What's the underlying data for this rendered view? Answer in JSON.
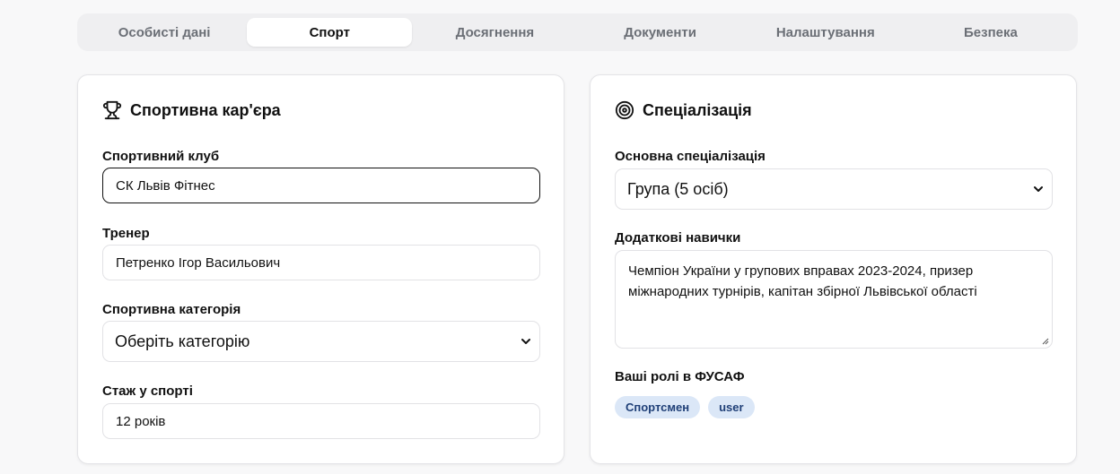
{
  "tabs": [
    {
      "label": "Особисті дані",
      "active": false
    },
    {
      "label": "Спорт",
      "active": true
    },
    {
      "label": "Досягнення",
      "active": false
    },
    {
      "label": "Документи",
      "active": false
    },
    {
      "label": "Налаштування",
      "active": false
    },
    {
      "label": "Безпека",
      "active": false
    }
  ],
  "career": {
    "title": "Спортивна кар'єра",
    "icon": "trophy-icon",
    "club_label": "Спортивний клуб",
    "club_value": "СК Львів Фітнес",
    "coach_label": "Тренер",
    "coach_value": "Петренко Ігор Васильович",
    "category_label": "Спортивна категорія",
    "category_value": "Оберіть категорію",
    "experience_label": "Стаж у спорті",
    "experience_value": "12 років"
  },
  "specialization": {
    "title": "Спеціалізація",
    "icon": "target-icon",
    "main_label": "Основна спеціалізація",
    "main_value": "Група (5 осіб)",
    "skills_label": "Додаткові навички",
    "skills_value": "Чемпіон України у групових вправах 2023-2024, призер міжнародних турнірів, капітан збірної Львівської області",
    "roles_label": "Ваші ролі в ФУСАФ",
    "roles": [
      "Спортсмен",
      "user"
    ]
  },
  "colors": {
    "badge_bg": "#dbe7f7",
    "badge_text": "#1f3f77"
  }
}
